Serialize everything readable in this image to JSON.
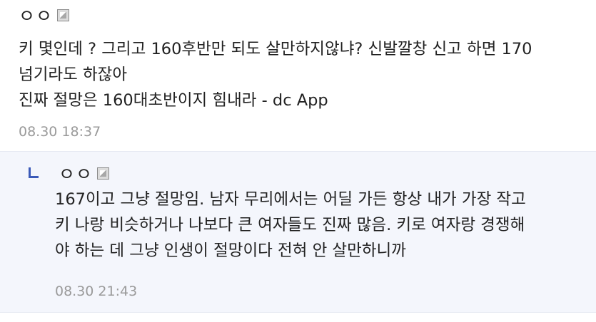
{
  "comments": [
    {
      "nickname": "ㅇㅇ",
      "lines": [
        "키 몇인데 ? 그리고 160후반만 되도 살만하지않냐? 신발깔창 신고 하면 170",
        "넘기라도 하잖아",
        "진짜 절망은 160대초반이지 힘내라 - dc App"
      ],
      "timestamp": "08.30 18:37"
    },
    {
      "nickname": "ㅇㅇ",
      "lines": [
        "167이고 그냥 절망임. 남자 무리에서는 어딜 가든 항상 내가 가장 작고",
        "키 나랑 비슷하거나 나보다 큰 여자들도 진짜 많음. 키로 여자랑 경쟁해",
        "야 하는 데 그냥 인생이 절망이다 전혀 안 살만하니까"
      ],
      "timestamp": "08.30 21:43"
    }
  ],
  "colors": {
    "reply_background": "#f4f6fc",
    "reply_arrow": "#3b5ab8",
    "timestamp": "#9a9a9a",
    "divider": "#e6e9f2"
  },
  "icons": {
    "gallog": "gallog-icon",
    "reply": "reply-arrow-icon"
  }
}
